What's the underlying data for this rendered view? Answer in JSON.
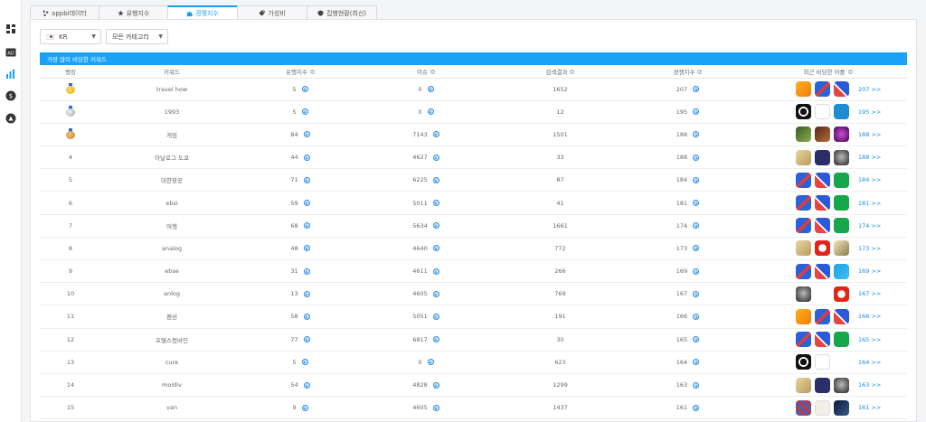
{
  "sidebar": {
    "icons": [
      "dashboard-icon",
      "ad-icon",
      "chart-icon",
      "dollar-icon",
      "store-icon"
    ]
  },
  "tabs": [
    {
      "label": "appbi데이터",
      "icon": "graph-icon",
      "active": false
    },
    {
      "label": "유행지수",
      "icon": "star-icon",
      "active": false
    },
    {
      "label": "경쟁지수",
      "icon": "puzzle-icon",
      "active": true
    },
    {
      "label": "가성비",
      "icon": "tag-icon",
      "active": false
    },
    {
      "label": "집행현황(최신)",
      "icon": "shield-icon",
      "active": false
    }
  ],
  "filters": {
    "country": "KR",
    "category": "모든 카테고리"
  },
  "card_title": "가장 많이 비딩한 키워드",
  "columns": {
    "rank": "랭킹",
    "keyword": "키워드",
    "trend": "유행지수",
    "issue": "이슈",
    "search": "검색결과",
    "competition": "경쟁지수",
    "recent_apps": "최근 비딩한 어플"
  },
  "rows": [
    {
      "rank": "",
      "medal": "gold",
      "keyword": "travel how",
      "trend": "5",
      "issue": "0",
      "search": "1652",
      "competition": "207",
      "count": "207 >>",
      "apps": [
        "bg-orange",
        "bg-redblue",
        "bg-redblue2"
      ]
    },
    {
      "rank": "",
      "medal": "silver",
      "keyword": "1993",
      "trend": "5",
      "issue": "0",
      "search": "12",
      "competition": "195",
      "count": "195 >>",
      "apps": [
        "bg-ring",
        "bg-white",
        "bg-wp"
      ]
    },
    {
      "rank": "",
      "medal": "bronze",
      "keyword": "게임",
      "trend": "84",
      "issue": "7143",
      "search": "1501",
      "competition": "188",
      "count": "188 >>",
      "apps": [
        "bg-game1",
        "bg-game2",
        "bg-purple"
      ]
    },
    {
      "rank": "4",
      "medal": "",
      "keyword": "아날로그 도쿄",
      "trend": "44",
      "issue": "4627",
      "search": "33",
      "competition": "188",
      "count": "188 >>",
      "apps": [
        "bg-parch",
        "bg-navy",
        "bg-face"
      ]
    },
    {
      "rank": "5",
      "medal": "",
      "keyword": "대한항공",
      "trend": "71",
      "issue": "6225",
      "search": "87",
      "competition": "184",
      "count": "184 >>",
      "apps": [
        "bg-redblue",
        "bg-redblue2",
        "bg-green"
      ]
    },
    {
      "rank": "6",
      "medal": "",
      "keyword": "ebsi",
      "trend": "59",
      "issue": "5011",
      "search": "41",
      "competition": "181",
      "count": "181 >>",
      "apps": [
        "bg-redblue",
        "bg-redblue2",
        "bg-green"
      ]
    },
    {
      "rank": "7",
      "medal": "",
      "keyword": "여행",
      "trend": "68",
      "issue": "5634",
      "search": "1661",
      "competition": "174",
      "count": "174 >>",
      "apps": [
        "bg-redblue",
        "bg-redblue2",
        "bg-green"
      ]
    },
    {
      "rank": "8",
      "medal": "",
      "keyword": "analog",
      "trend": "48",
      "issue": "4640",
      "search": "772",
      "competition": "173",
      "count": "173 >>",
      "apps": [
        "bg-parch",
        "bg-red",
        "bg-road"
      ]
    },
    {
      "rank": "9",
      "medal": "",
      "keyword": "ebse",
      "trend": "31",
      "issue": "4611",
      "search": "266",
      "competition": "169",
      "count": "169 >>",
      "apps": [
        "bg-redblue",
        "bg-redblue2",
        "bg-cyan"
      ]
    },
    {
      "rank": "10",
      "medal": "",
      "keyword": "anlog",
      "trend": "13",
      "issue": "4605",
      "search": "769",
      "competition": "167",
      "count": "167 >>",
      "apps": [
        "bg-face",
        "bg-dots",
        "bg-red"
      ]
    },
    {
      "rank": "11",
      "medal": "",
      "keyword": "펜션",
      "trend": "58",
      "issue": "5051",
      "search": "191",
      "competition": "166",
      "count": "166 >>",
      "apps": [
        "bg-orange",
        "bg-redblue",
        "bg-redblue2"
      ]
    },
    {
      "rank": "12",
      "medal": "",
      "keyword": "호텔스컴바인",
      "trend": "77",
      "issue": "6817",
      "search": "30",
      "competition": "165",
      "count": "165 >>",
      "apps": [
        "bg-redblue",
        "bg-redblue2",
        "bg-green"
      ]
    },
    {
      "rank": "13",
      "medal": "",
      "keyword": "cure",
      "trend": "5",
      "issue": "0",
      "search": "623",
      "competition": "164",
      "count": "164 >>",
      "apps": [
        "bg-ring",
        "bg-white",
        "bg-cloud"
      ]
    },
    {
      "rank": "14",
      "medal": "",
      "keyword": "moldiv",
      "trend": "54",
      "issue": "4828",
      "search": "1299",
      "competition": "163",
      "count": "163 >>",
      "apps": [
        "bg-parch",
        "bg-navy",
        "bg-face"
      ]
    },
    {
      "rank": "15",
      "medal": "",
      "keyword": "van",
      "trend": "9",
      "issue": "4605",
      "search": "1437",
      "competition": "161",
      "count": "161 >>",
      "apps": [
        "bg-mosaic",
        "bg-paper",
        "bg-dark"
      ]
    }
  ]
}
